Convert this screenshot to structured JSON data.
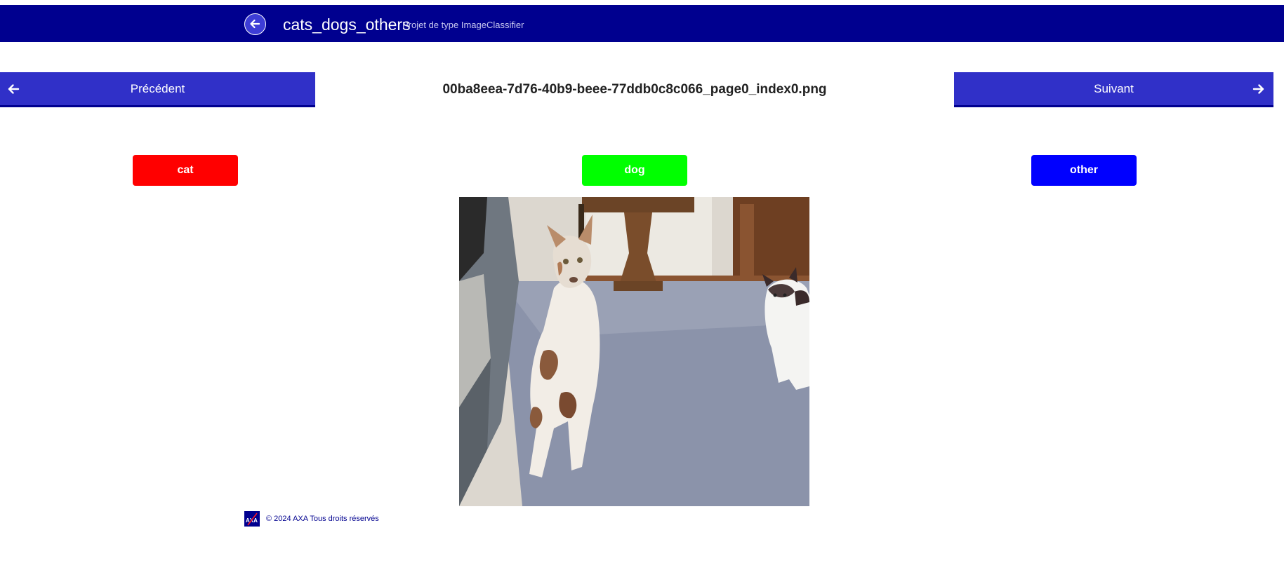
{
  "header": {
    "project_name": "cats_dogs_others",
    "project_type": "Projet de type ImageClassifier",
    "back_icon": "arrow-left-circle-icon"
  },
  "navigation": {
    "previous_label": "Précédent",
    "next_label": "Suivant",
    "previous_icon": "arrow-left-icon",
    "next_icon": "arrow-right-icon"
  },
  "file": {
    "name": "00ba8eea-7d76-40b9-beee-77ddb0c8c066_page0_index0.png"
  },
  "labels": [
    {
      "text": "cat",
      "color": "#ff0000"
    },
    {
      "text": "dog",
      "color": "#00ff00"
    },
    {
      "text": "other",
      "color": "#0000ff"
    }
  ],
  "footer": {
    "logo_text": "AXA",
    "copyright": "© 2024 AXA Tous droits réservés"
  },
  "theme": {
    "header_bg": "#00008f",
    "nav_button_bg": "#3030c8"
  }
}
